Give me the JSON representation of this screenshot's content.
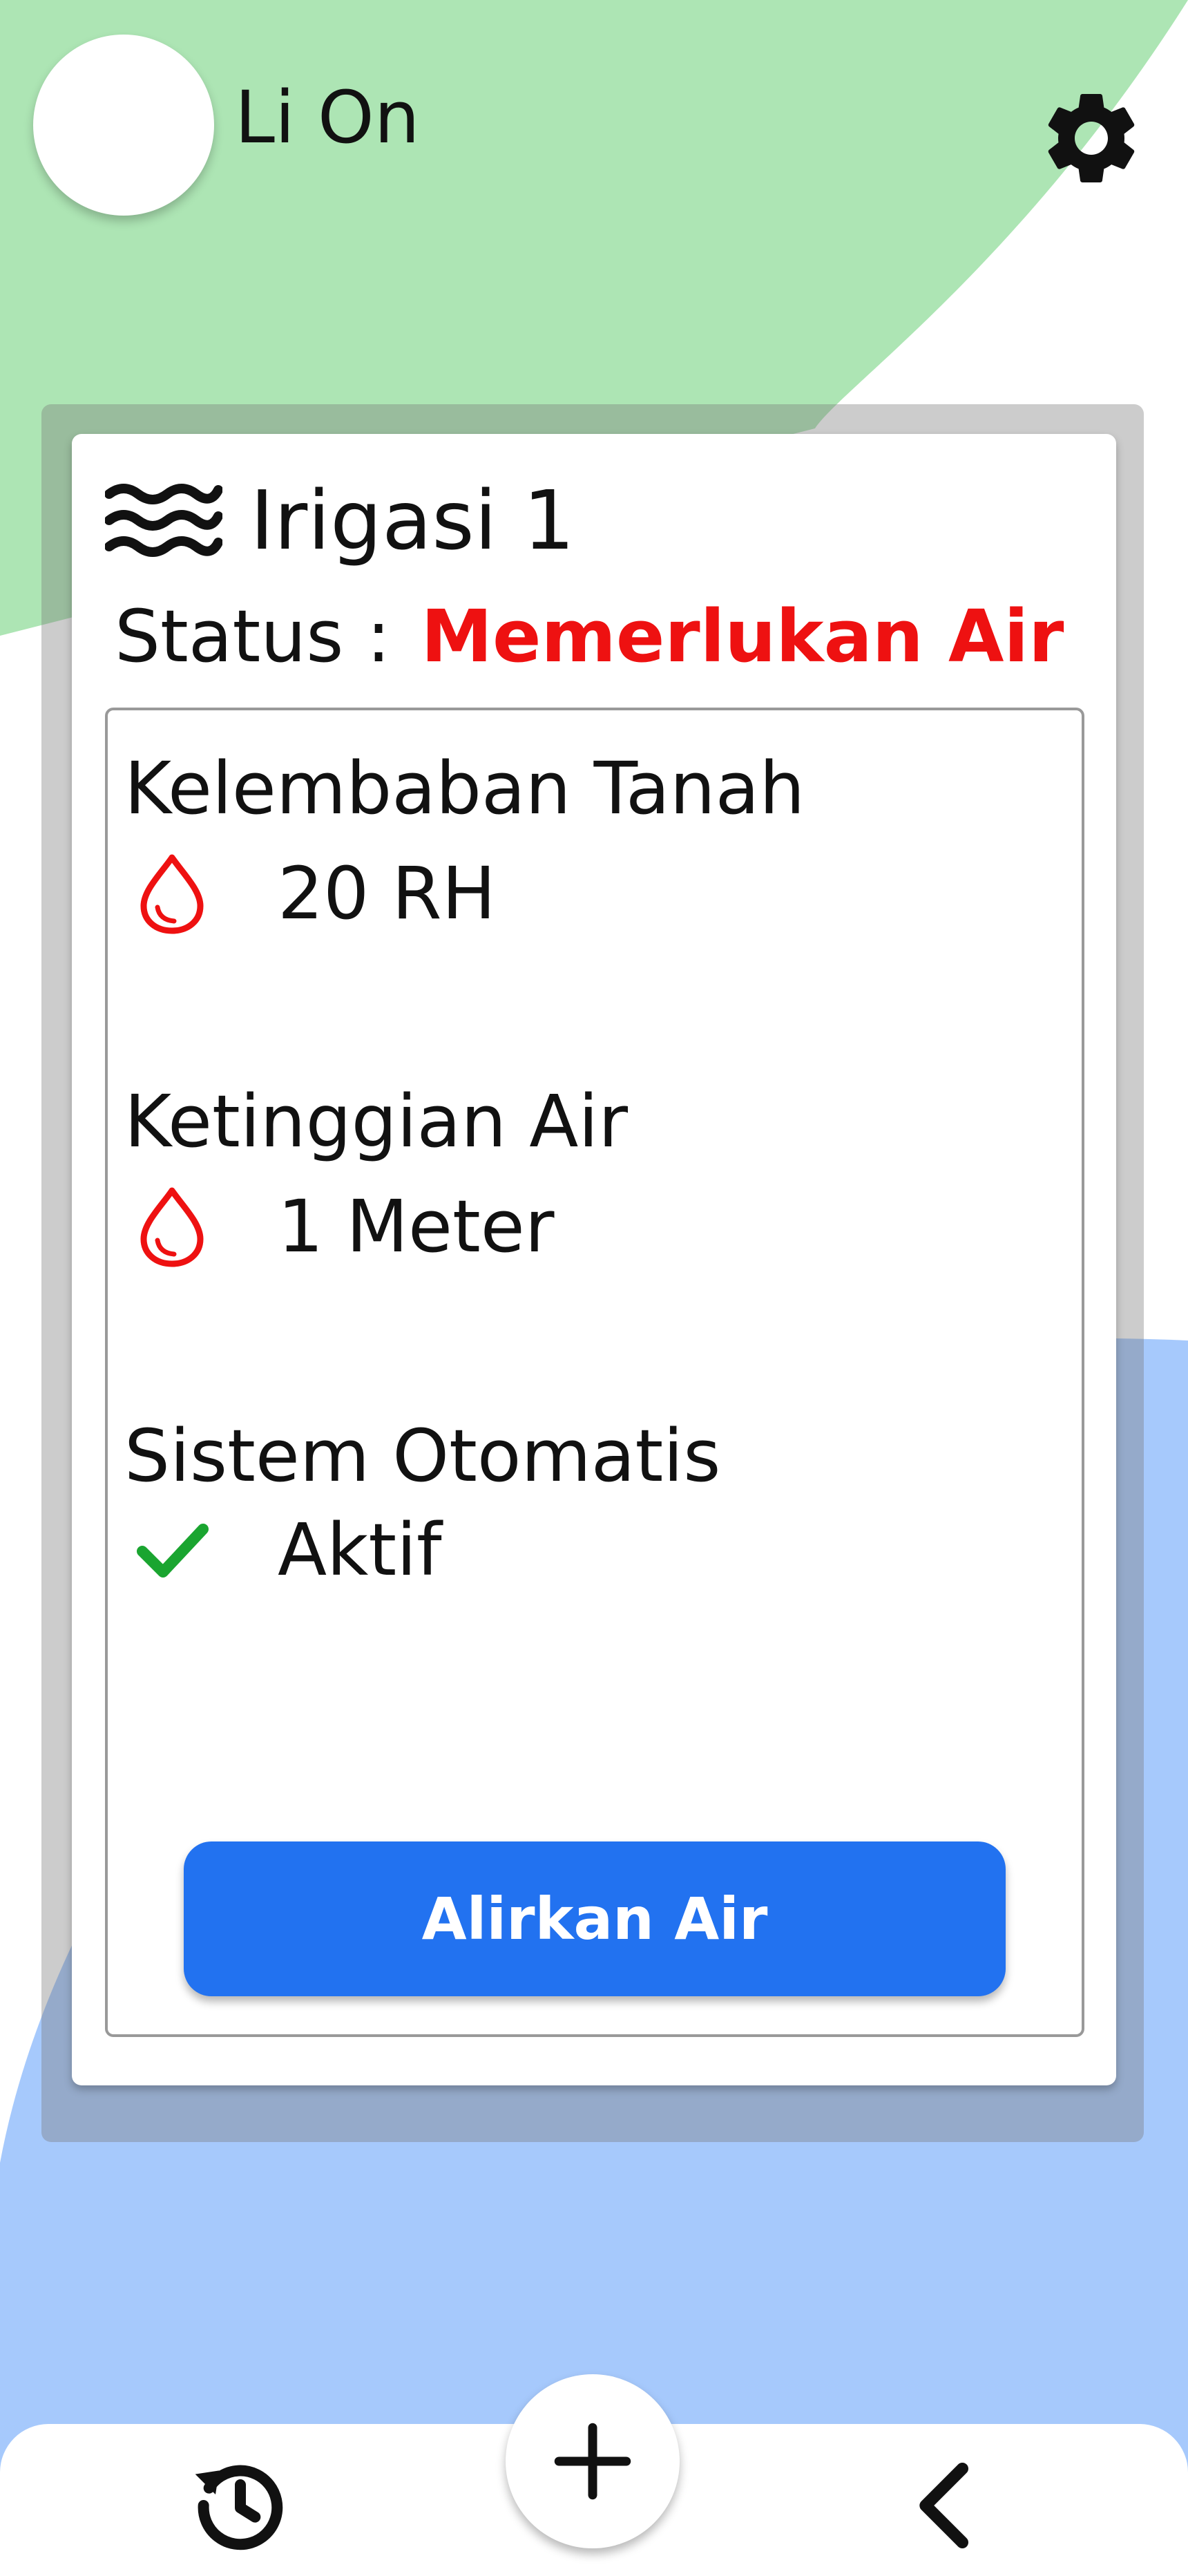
{
  "app": {
    "title": "Li On"
  },
  "card": {
    "title": "Irigasi 1",
    "status_label": "Status :",
    "status_value": "Memerlukan Air",
    "metrics": [
      {
        "label": "Kelembaban Tanah",
        "value": "20 RH",
        "icon": "water-drop-icon"
      },
      {
        "label": "Ketinggian Air",
        "value": "1 Meter",
        "icon": "water-drop-icon"
      },
      {
        "label": "Sistem Otomatis",
        "value": "Aktif",
        "icon": "checkmark-icon"
      }
    ],
    "action_label": "Alirkan Air"
  },
  "bottom_nav": {
    "items": [
      {
        "icon": "history-icon"
      },
      {
        "icon": "add-icon"
      },
      {
        "icon": "chevron-left-icon"
      }
    ]
  },
  "colors": {
    "top_blob": "#ade5b4",
    "bottom_blob": "#a6c9fc",
    "status_alert": "#ee1111",
    "drop_icon": "#ee1111",
    "check_icon": "#1aa530",
    "primary_button": "#2272f0"
  }
}
